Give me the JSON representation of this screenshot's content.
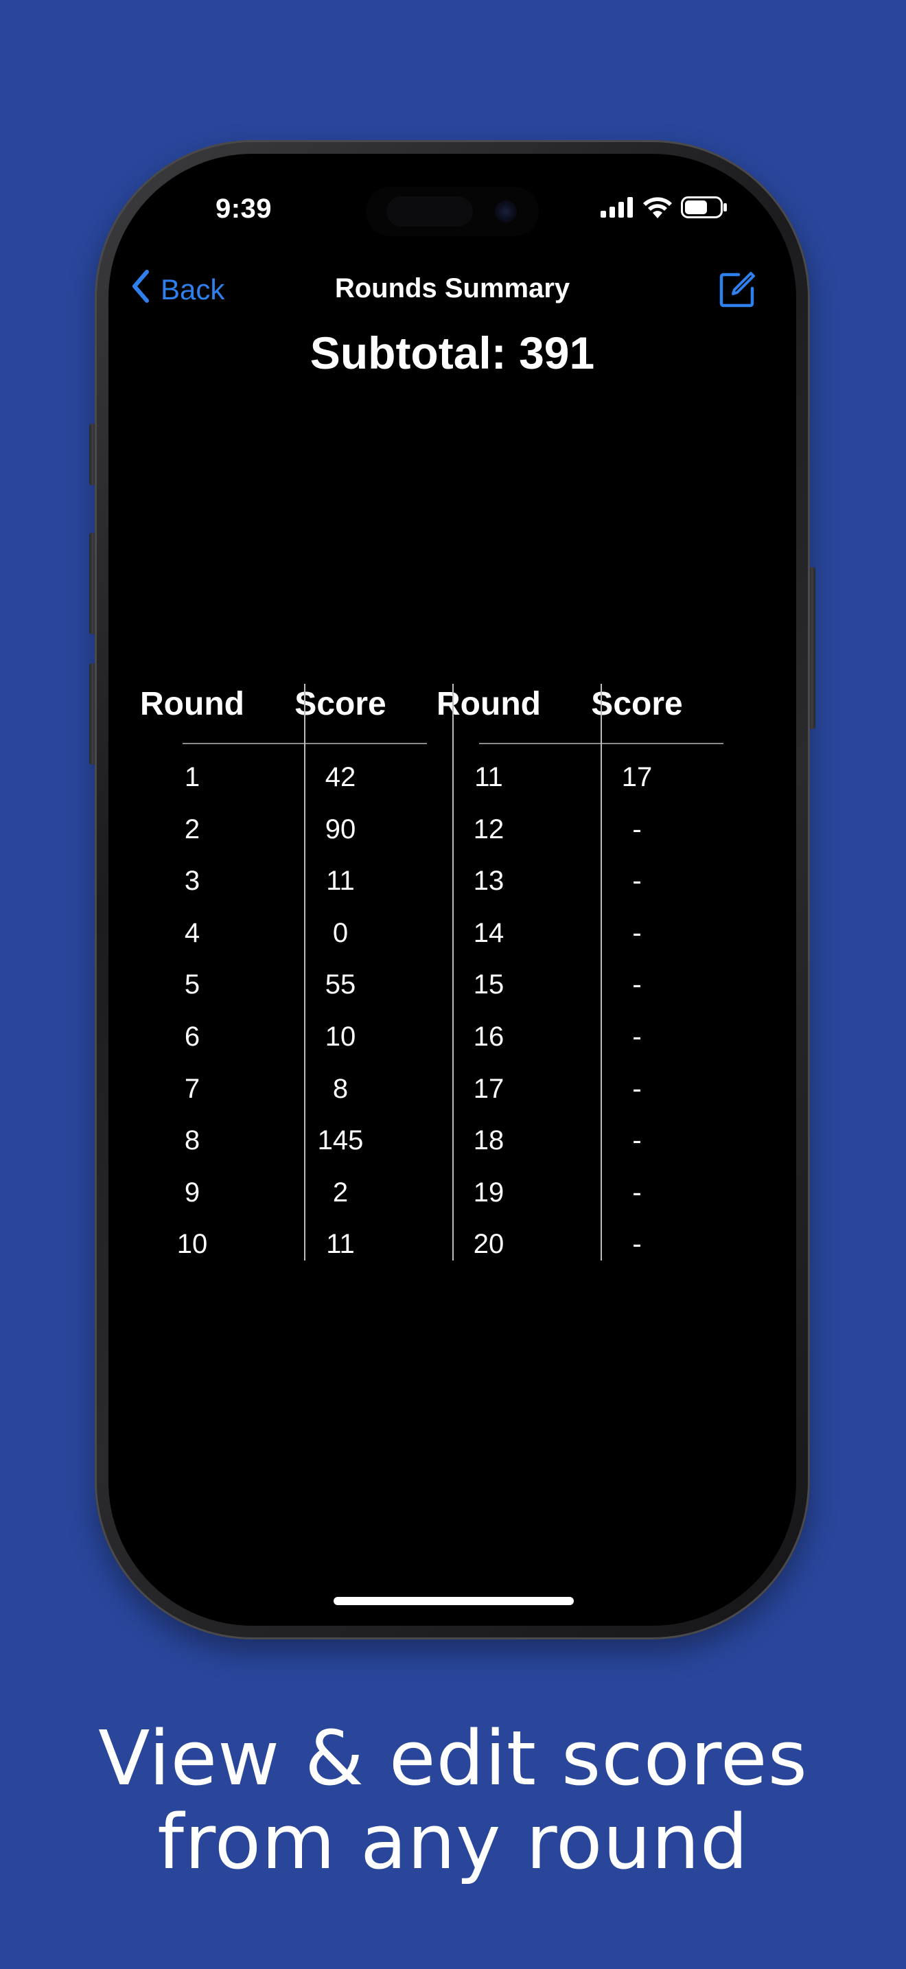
{
  "colors": {
    "background": "#29469b",
    "screen": "#000000",
    "accent": "#2f80ed",
    "text": "#ffffff"
  },
  "status_bar": {
    "time": "9:39",
    "icons": [
      "cellular-signal-icon",
      "wifi-icon",
      "battery-icon"
    ]
  },
  "nav": {
    "back_label": "Back",
    "back_icon": "chevron-left-icon",
    "title": "Rounds Summary",
    "edit_icon": "compose-icon"
  },
  "subtotal": "Subtotal: 391",
  "table": {
    "headers": [
      "Round",
      "Score",
      "Round",
      "Score"
    ],
    "rows": [
      {
        "round_a": "1",
        "score_a": "42",
        "round_b": "11",
        "score_b": "17"
      },
      {
        "round_a": "2",
        "score_a": "90",
        "round_b": "12",
        "score_b": "-"
      },
      {
        "round_a": "3",
        "score_a": "11",
        "round_b": "13",
        "score_b": "-"
      },
      {
        "round_a": "4",
        "score_a": "0",
        "round_b": "14",
        "score_b": "-"
      },
      {
        "round_a": "5",
        "score_a": "55",
        "round_b": "15",
        "score_b": "-"
      },
      {
        "round_a": "6",
        "score_a": "10",
        "round_b": "16",
        "score_b": "-"
      },
      {
        "round_a": "7",
        "score_a": "8",
        "round_b": "17",
        "score_b": "-"
      },
      {
        "round_a": "8",
        "score_a": "145",
        "round_b": "18",
        "score_b": "-"
      },
      {
        "round_a": "9",
        "score_a": "2",
        "round_b": "19",
        "score_b": "-"
      },
      {
        "round_a": "10",
        "score_a": "11",
        "round_b": "20",
        "score_b": "-"
      }
    ]
  },
  "caption": {
    "line1": "View & edit scores",
    "line2": "from any round"
  }
}
